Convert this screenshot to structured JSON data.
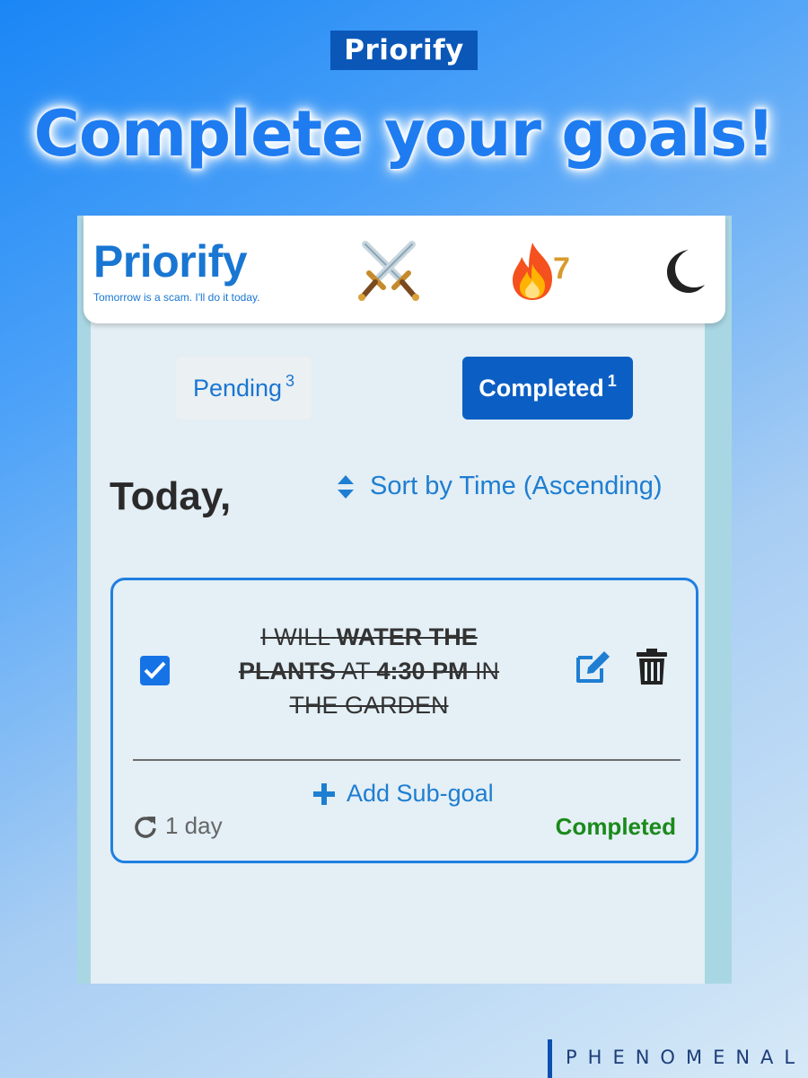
{
  "promo": {
    "badge": "Priorify",
    "headline": "Complete your goals!",
    "brand": "PHENOMENAL"
  },
  "header": {
    "title": "Priorify",
    "tagline": "Tomorrow is a scam. I'll do it today.",
    "streak_count": "7",
    "icons": [
      "crossed-swords-icon",
      "fire-icon",
      "moon-icon"
    ]
  },
  "tabs": [
    {
      "label": "Pending",
      "count": "3",
      "active": false
    },
    {
      "label": "Completed",
      "count": "1",
      "active": true
    }
  ],
  "section": {
    "heading": "Today,",
    "sort_label": "Sort by Time (Ascending)"
  },
  "goals": [
    {
      "text_parts": {
        "prefix": "I will",
        "action": "water the plants",
        "at": "at",
        "time": "4:30 PM",
        "place": "in the garden"
      },
      "checked": true,
      "add_subgoal_label": "Add Sub-goal",
      "repeat": "1 day",
      "status": "Completed"
    }
  ],
  "colors": {
    "primary": "#1976d2",
    "active_tab": "#0b5fc4",
    "completed_status": "#1a8a1a",
    "card_border": "#1f7fe0"
  }
}
